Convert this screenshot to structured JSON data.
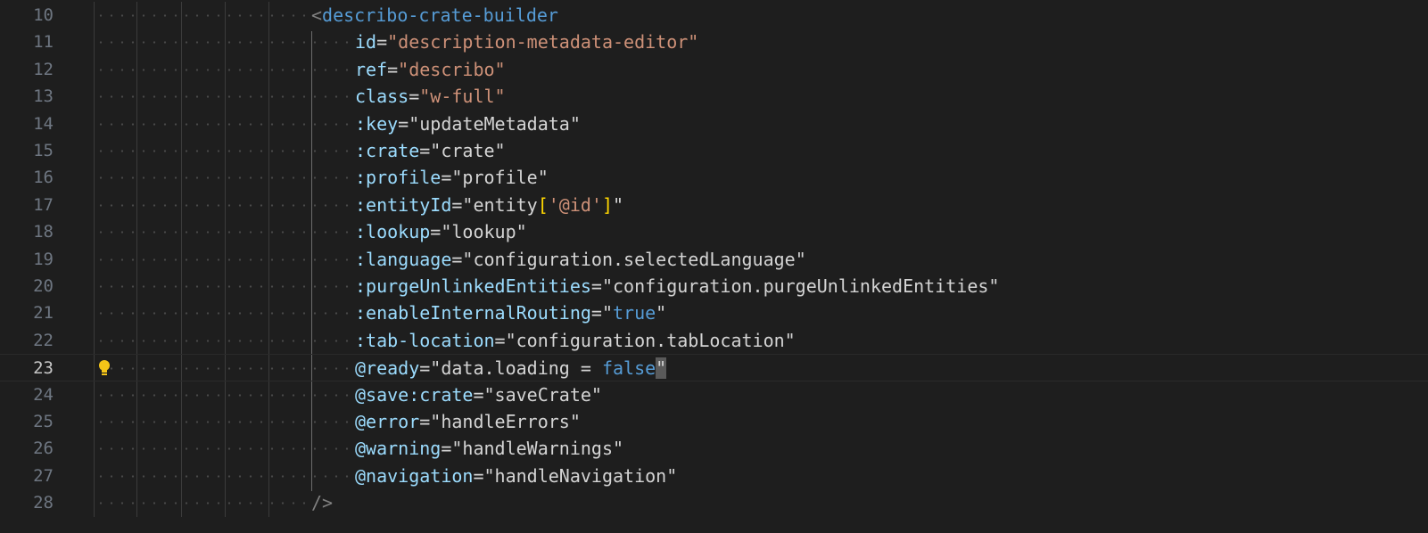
{
  "editor": {
    "current_line": "23",
    "lines": [
      {
        "num": "10",
        "tokens": [
          {
            "t": "<",
            "c": "bracket"
          },
          {
            "t": "describo-crate-builder",
            "c": "tag"
          }
        ],
        "indent": 1
      },
      {
        "num": "11",
        "tokens": [
          {
            "t": "id",
            "c": "attr"
          },
          {
            "t": "=",
            "c": "text"
          },
          {
            "t": "\"description-metadata-editor\"",
            "c": "str"
          }
        ],
        "indent": 2
      },
      {
        "num": "12",
        "tokens": [
          {
            "t": "ref",
            "c": "attr"
          },
          {
            "t": "=",
            "c": "text"
          },
          {
            "t": "\"describo\"",
            "c": "str"
          }
        ],
        "indent": 2
      },
      {
        "num": "13",
        "tokens": [
          {
            "t": "class",
            "c": "attr"
          },
          {
            "t": "=",
            "c": "text"
          },
          {
            "t": "\"w-full\"",
            "c": "str"
          }
        ],
        "indent": 2
      },
      {
        "num": "14",
        "tokens": [
          {
            "t": ":key",
            "c": "attr"
          },
          {
            "t": "=\"updateMetadata\"",
            "c": "text"
          }
        ],
        "indent": 2
      },
      {
        "num": "15",
        "tokens": [
          {
            "t": ":crate",
            "c": "attr"
          },
          {
            "t": "=\"crate\"",
            "c": "text"
          }
        ],
        "indent": 2
      },
      {
        "num": "16",
        "tokens": [
          {
            "t": ":profile",
            "c": "attr"
          },
          {
            "t": "=\"profile\"",
            "c": "text"
          }
        ],
        "indent": 2
      },
      {
        "num": "17",
        "tokens": [
          {
            "t": ":entityId",
            "c": "attr"
          },
          {
            "t": "=\"entity",
            "c": "text"
          },
          {
            "t": "[",
            "c": "gold"
          },
          {
            "t": "'@id'",
            "c": "str"
          },
          {
            "t": "]",
            "c": "gold"
          },
          {
            "t": "\"",
            "c": "text"
          }
        ],
        "indent": 2
      },
      {
        "num": "18",
        "tokens": [
          {
            "t": ":lookup",
            "c": "attr"
          },
          {
            "t": "=\"lookup\"",
            "c": "text"
          }
        ],
        "indent": 2
      },
      {
        "num": "19",
        "tokens": [
          {
            "t": ":language",
            "c": "attr"
          },
          {
            "t": "=\"configuration.selectedLanguage\"",
            "c": "text"
          }
        ],
        "indent": 2
      },
      {
        "num": "20",
        "tokens": [
          {
            "t": ":purgeUnlinkedEntities",
            "c": "attr"
          },
          {
            "t": "=\"configuration.purgeUnlinkedEntities\"",
            "c": "text"
          }
        ],
        "indent": 2
      },
      {
        "num": "21",
        "tokens": [
          {
            "t": ":enableInternalRouting",
            "c": "attr"
          },
          {
            "t": "=\"",
            "c": "text"
          },
          {
            "t": "true",
            "c": "kw"
          },
          {
            "t": "\"",
            "c": "text"
          }
        ],
        "indent": 2
      },
      {
        "num": "22",
        "tokens": [
          {
            "t": ":tab-location",
            "c": "attr"
          },
          {
            "t": "=\"configuration.tabLocation\"",
            "c": "text"
          }
        ],
        "indent": 2
      },
      {
        "num": "23",
        "tokens": [
          {
            "t": "@ready",
            "c": "attr"
          },
          {
            "t": "=\"data.loading = ",
            "c": "text"
          },
          {
            "t": "false",
            "c": "kw"
          },
          {
            "t": "\"",
            "c": "cursor"
          }
        ],
        "indent": 2
      },
      {
        "num": "24",
        "tokens": [
          {
            "t": "@save:crate",
            "c": "attr"
          },
          {
            "t": "=\"saveCrate\"",
            "c": "text"
          }
        ],
        "indent": 2
      },
      {
        "num": "25",
        "tokens": [
          {
            "t": "@error",
            "c": "attr"
          },
          {
            "t": "=\"handleErrors\"",
            "c": "text"
          }
        ],
        "indent": 2
      },
      {
        "num": "26",
        "tokens": [
          {
            "t": "@warning",
            "c": "attr"
          },
          {
            "t": "=\"handleWarnings\"",
            "c": "text"
          }
        ],
        "indent": 2
      },
      {
        "num": "27",
        "tokens": [
          {
            "t": "@navigation",
            "c": "attr"
          },
          {
            "t": "=\"handleNavigation\"",
            "c": "text"
          }
        ],
        "indent": 2
      },
      {
        "num": "28",
        "tokens": [
          {
            "t": "/>",
            "c": "bracket"
          }
        ],
        "indent": 1
      }
    ]
  },
  "icons": {
    "lightbulb": "lightbulb-icon",
    "lightbulb_color": "#f5c518"
  },
  "colors": {
    "background": "#1e1e1e",
    "tag": "#569cd6",
    "attribute": "#9cdcfe",
    "string": "#ce9178",
    "bracket_gold": "#ffd700"
  }
}
